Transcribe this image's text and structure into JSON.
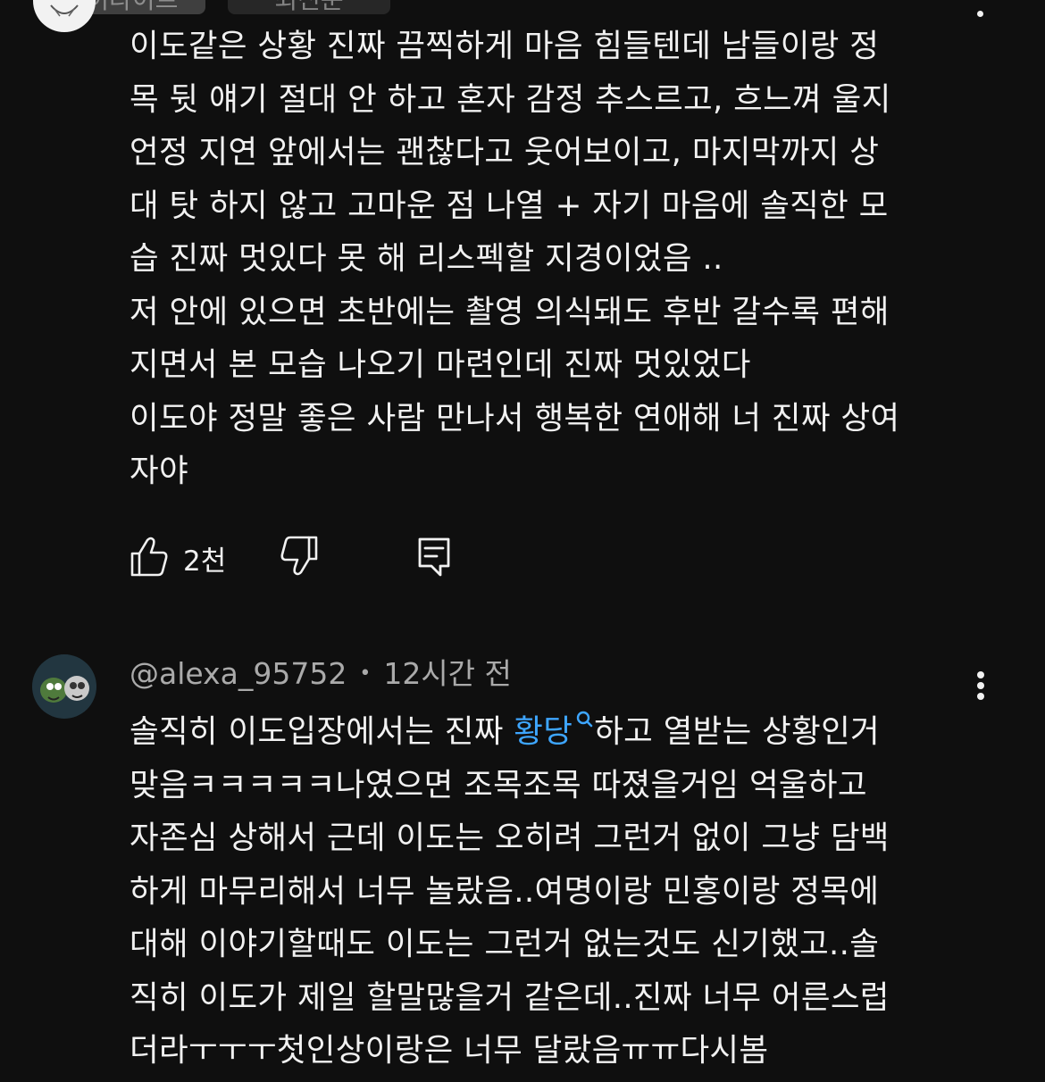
{
  "top": {
    "chip1_label": "하이라이트",
    "chip2_label": "최신순"
  },
  "comment1": {
    "text": "이도같은 상황 진짜 끔찍하게 마음 힘들텐데 남들이랑 정\n목 뒷 얘기 절대 안 하고 혼자 감정 추스르고, 흐느껴 울지\n언정 지연 앞에서는 괜찮다고 웃어보이고, 마지막까지 상\n대 탓 하지 않고 고마운 점 나열 + 자기 마음에 솔직한 모\n습 진짜 멋있다 못 해 리스펙할 지경이었음 ..\n저 안에 있으면 초반에는 촬영 의식돼도 후반 갈수록 편해\n지면서 본 모습 나오기 마련인데 진짜 멋있었다\n이도야 정말 좋은 사람 만나서 행복한 연애해 너 진짜 상여\n자야",
    "like_count": "2천"
  },
  "comment2": {
    "author": "@alexa_95752",
    "separator": "•",
    "time": "12시간 전",
    "text_before_link": "솔직히 이도입장에서는 진짜 ",
    "link_text": "황당",
    "text_after_link": "하고 열받는 상황인거\n맞음ㅋㅋㅋㅋㅋ나였으면 조목조목 따졌을거임 억울하고\n자존심 상해서 근데 이도는 오히려 그런거 없이 그냥 담백\n하게 마무리해서 너무 놀랐음..여명이랑 민홍이랑 정목에\n대해 이야기할때도 이도는 그런거 없는것도 신기했고..솔\n직히 이도가 제일 할말많을거 같은데..진짜 너무 어른스럽\n더라ㅜㅜㅜ첫인상이랑은 너무 달랐음ㅠㅠ다시봄"
  },
  "icons": {
    "like": "thumbs-up-icon",
    "dislike": "thumbs-down-icon",
    "reply": "reply-icon",
    "more": "more-vertical-icon",
    "search": "search-icon"
  },
  "colors": {
    "background": "#0f0f0f",
    "text": "#f1f1f1",
    "meta": "#aaaaaa",
    "link": "#3ea6ff"
  }
}
